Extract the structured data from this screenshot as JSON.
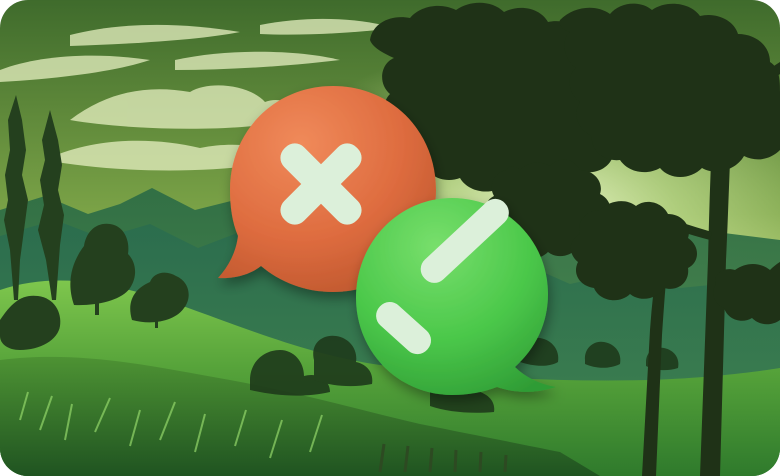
{
  "image": {
    "alt": "",
    "icons": [
      "reject-bubble-icon",
      "approve-bubble-icon"
    ],
    "colors": {
      "sky_top": "#3f6b2c",
      "sky_glow": "#d7f0a1",
      "mountain": "#2f6a3f",
      "hill_light": "#6fb63f",
      "hill_dark": "#245028",
      "tree_silhouette": "#1f3217",
      "reject_bubble": "#dd6b3f",
      "approve_bubble": "#49c84a",
      "symbol": "#dcf0da"
    }
  }
}
